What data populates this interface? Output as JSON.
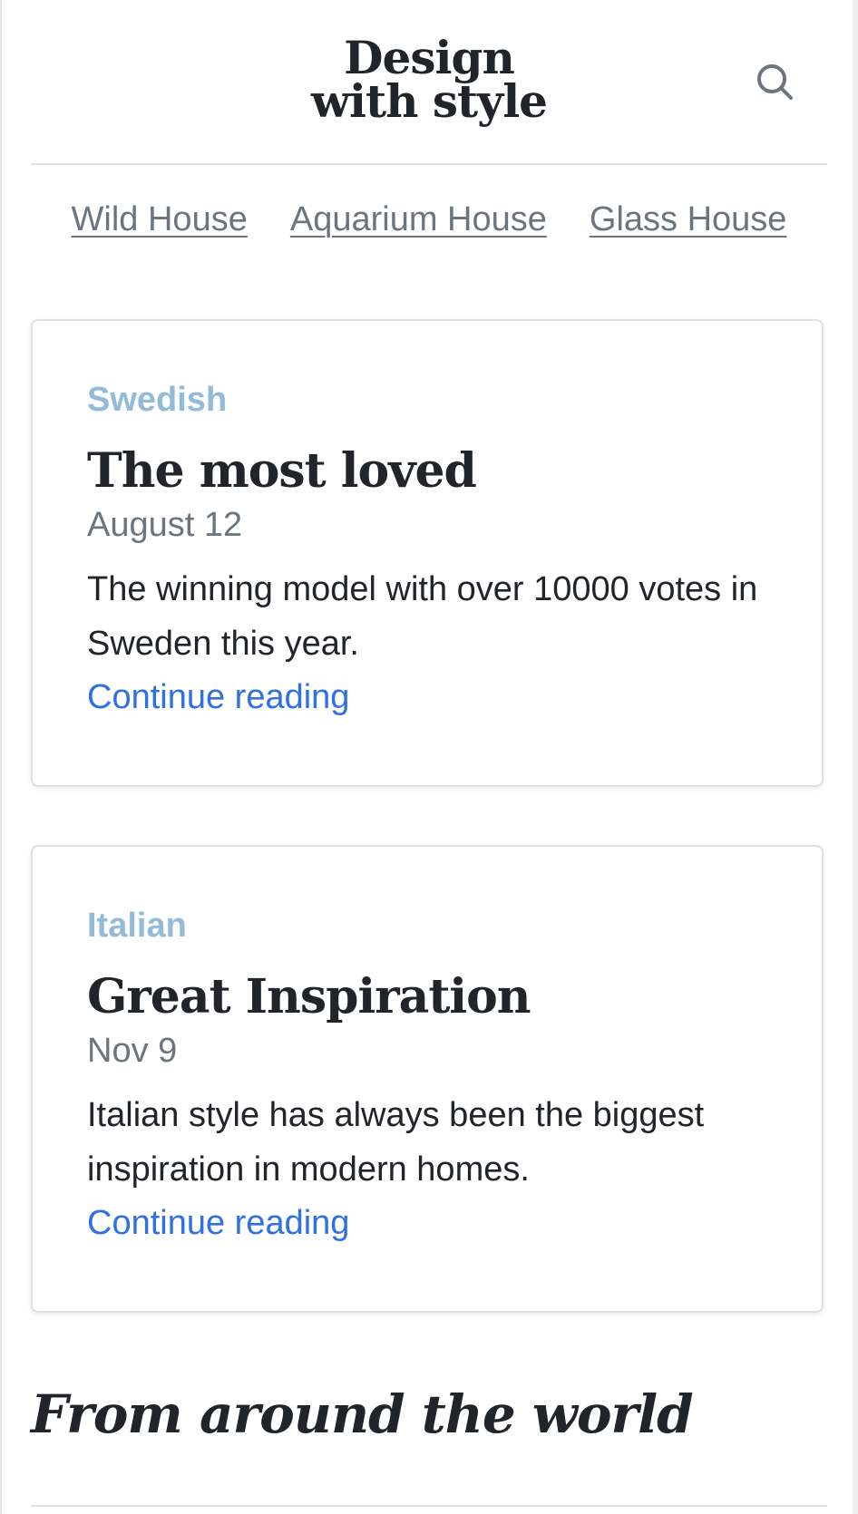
{
  "header": {
    "logo_line1": "Design",
    "logo_line2": "with style",
    "search_icon": "search-icon"
  },
  "nav": {
    "items": [
      {
        "label": "Wild House"
      },
      {
        "label": "Aquarium House"
      },
      {
        "label": "Glass House"
      }
    ]
  },
  "cards": [
    {
      "category": "Swedish",
      "title": "The most loved",
      "date": "August 12",
      "text": "The winning model with over 10000 votes in Sweden this year.",
      "link": "Continue reading"
    },
    {
      "category": "Italian",
      "title": "Great Inspiration",
      "date": "Nov 9",
      "text": "Italian style has always been the biggest inspiration in modern homes.",
      "link": "Continue reading"
    }
  ],
  "section": {
    "heading": "From around the world"
  },
  "colors": {
    "category": "#93bbd9",
    "link": "#2f6fe8",
    "muted": "#6c757d",
    "text": "#212529",
    "border": "#dee2e6"
  }
}
